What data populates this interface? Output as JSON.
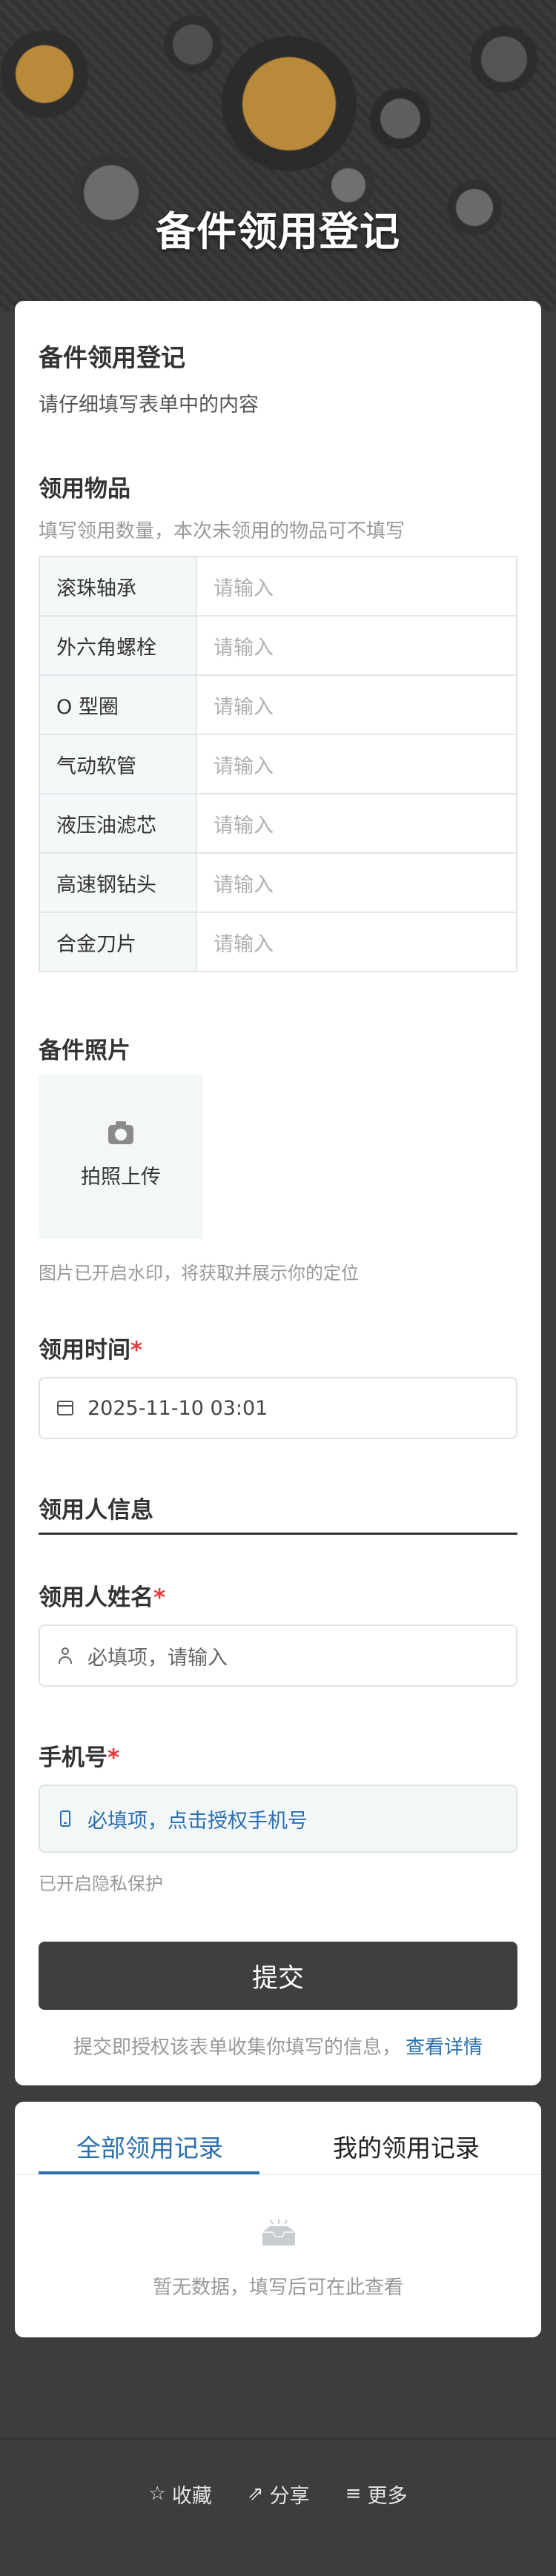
{
  "hero": {
    "title": "备件领用登记"
  },
  "form": {
    "title": "备件领用登记",
    "subtitle": "请仔细填写表单中的内容",
    "items_section": {
      "title": "领用物品",
      "hint": "填写领用数量，本次未领用的物品可不填写",
      "placeholder": "请输入",
      "rows": [
        "滚珠轴承",
        "外六角螺栓",
        "O 型圈",
        "气动软管",
        "液压油滤芯",
        "高速钢钻头",
        "合金刀片"
      ]
    },
    "photo_section": {
      "title": "备件照片",
      "upload_label": "拍照上传",
      "hint": "图片已开启水印，将获取并展示你的定位"
    },
    "time_section": {
      "title": "领用时间",
      "required_mark": "*",
      "value": "2025-11-10 03:01"
    },
    "recipient_header": "领用人信息",
    "name_section": {
      "title": "领用人姓名",
      "required_mark": "*",
      "placeholder": "必填项，请输入"
    },
    "phone_section": {
      "title": "手机号",
      "required_mark": "*",
      "button_label": "必填项，点击授权手机号",
      "hint": "已开启隐私保护"
    },
    "submit_label": "提交",
    "agreement_text": "提交即授权该表单收集你填写的信息，",
    "agreement_link": "查看详情"
  },
  "records": {
    "tabs": [
      "全部领用记录",
      "我的领用记录"
    ],
    "active_tab": 0,
    "empty_text": "暂无数据，填写后可在此查看"
  },
  "footer": {
    "items": [
      {
        "icon": "star-icon",
        "label": "收藏"
      },
      {
        "icon": "share-icon",
        "label": "分享"
      },
      {
        "icon": "menu-icon",
        "label": "更多"
      }
    ]
  },
  "colors": {
    "accent": "#2a6fb0",
    "required": "#e23b3b",
    "submit_bg": "#3e3f40",
    "page_bg": "#3c3d3e"
  }
}
